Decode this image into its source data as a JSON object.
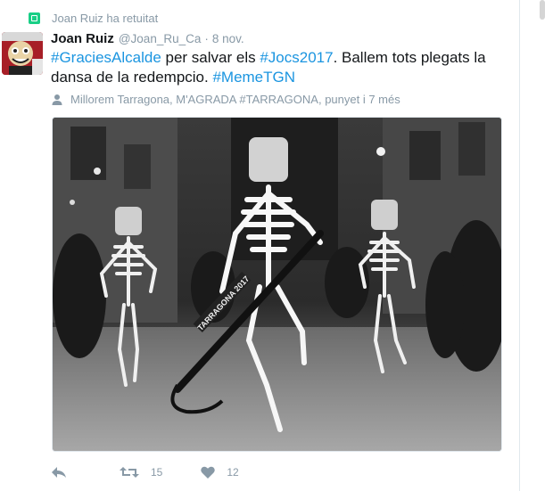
{
  "retweet_context": "Joan Ruiz ha retuitat",
  "tweet": {
    "name": "Joan Ruiz",
    "handle": "@Joan_Ru_Ca",
    "separator": "·",
    "time": "8 nov.",
    "text_parts": [
      {
        "text": "#GraciesAlcalde",
        "type": "hashtag"
      },
      {
        "text": " per salvar els ",
        "type": "plain"
      },
      {
        "text": "#Jocs2017",
        "type": "hashtag"
      },
      {
        "text": ". Ballem tots plegats la dansa de la redempcio. ",
        "type": "plain"
      },
      {
        "text": "#MemeTGN",
        "type": "hashtag"
      }
    ],
    "location": "Millorem Tarragona, M'AGRADA #TARRAGONA, punyet i 7 més",
    "image_caption": "TARRAGONA 2017"
  },
  "actions": {
    "reply_icon": "reply-icon",
    "retweet_icon": "retweet-icon",
    "retweet_count": "15",
    "like_icon": "heart-icon",
    "like_count": "12"
  },
  "colors": {
    "hashtag": "#1b95e0",
    "muted": "#8899a6",
    "retweet_badge": "#19cf86"
  }
}
